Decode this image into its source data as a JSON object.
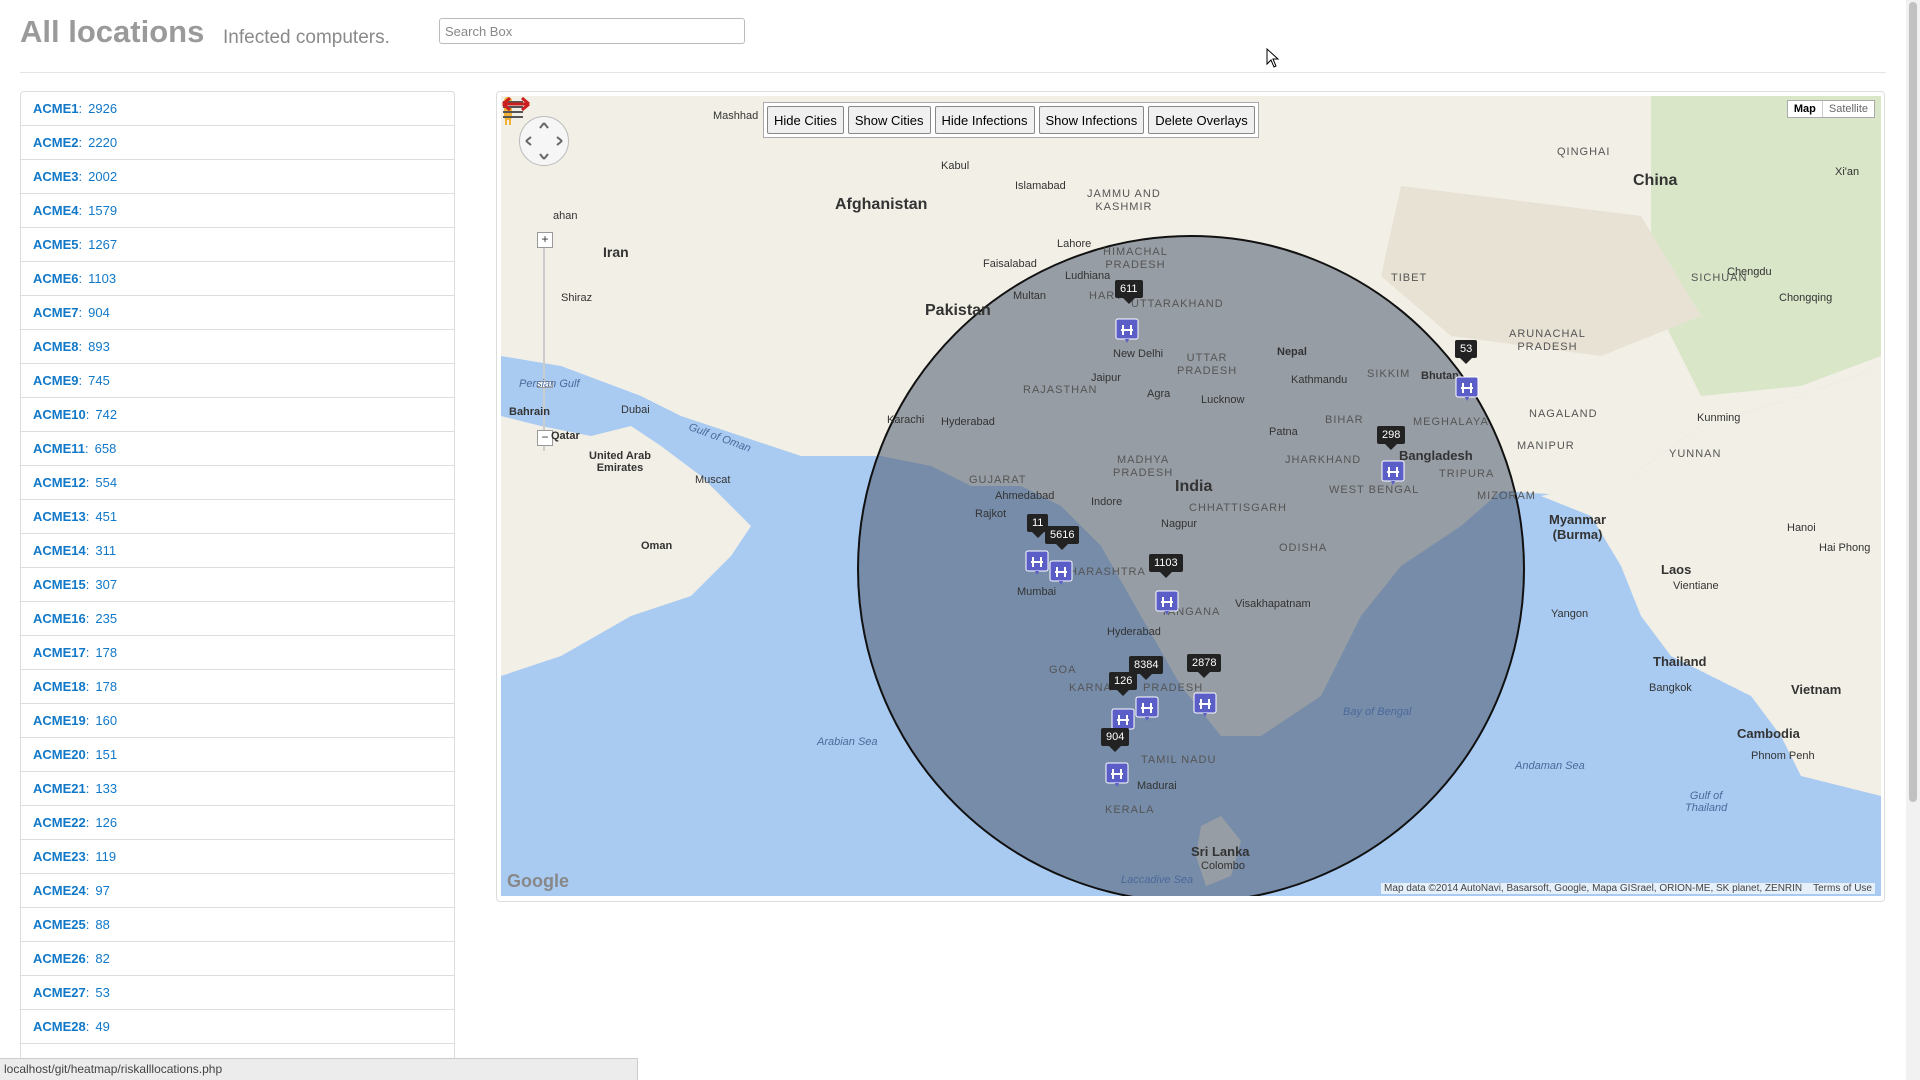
{
  "header": {
    "title": "All locations",
    "subtitle": "Infected computers.",
    "search_placeholder": "Search Box"
  },
  "locations": [
    {
      "name": "ACME1",
      "count": "2926"
    },
    {
      "name": "ACME2",
      "count": "2220"
    },
    {
      "name": "ACME3",
      "count": "2002"
    },
    {
      "name": "ACME4",
      "count": "1579"
    },
    {
      "name": "ACME5",
      "count": "1267"
    },
    {
      "name": "ACME6",
      "count": "1103"
    },
    {
      "name": "ACME7",
      "count": "904"
    },
    {
      "name": "ACME8",
      "count": "893"
    },
    {
      "name": "ACME9",
      "count": "745"
    },
    {
      "name": "ACME10",
      "count": "742"
    },
    {
      "name": "ACME11",
      "count": "658"
    },
    {
      "name": "ACME12",
      "count": "554"
    },
    {
      "name": "ACME13",
      "count": "451"
    },
    {
      "name": "ACME14",
      "count": "311"
    },
    {
      "name": "ACME15",
      "count": "307"
    },
    {
      "name": "ACME16",
      "count": "235"
    },
    {
      "name": "ACME17",
      "count": "178"
    },
    {
      "name": "ACME18",
      "count": "178"
    },
    {
      "name": "ACME19",
      "count": "160"
    },
    {
      "name": "ACME20",
      "count": "151"
    },
    {
      "name": "ACME21",
      "count": "133"
    },
    {
      "name": "ACME22",
      "count": "126"
    },
    {
      "name": "ACME23",
      "count": "119"
    },
    {
      "name": "ACME24",
      "count": "97"
    },
    {
      "name": "ACME25",
      "count": "88"
    },
    {
      "name": "ACME26",
      "count": "82"
    },
    {
      "name": "ACME27",
      "count": "53"
    },
    {
      "name": "ACME28",
      "count": "49"
    }
  ],
  "map": {
    "buttons": {
      "hide_cities": "Hide Cities",
      "show_cities": "Show Cities",
      "hide_infections": "Hide Infections",
      "show_infections": "Show Infections",
      "delete_overlays": "Delete Overlays"
    },
    "map_type": {
      "map": "Map",
      "satellite": "Satellite"
    },
    "logo": "Google",
    "attribution": "Map data ©2014 AutoNavi, Basarsoft, Google, Mapa GISrael, ORION-ME, SK planet, ZENRIN",
    "terms": "Terms of Use",
    "labels": {
      "afghanistan": "Afghanistan",
      "iran": "Iran",
      "pakistan": "Pakistan",
      "india": "India",
      "china": "China",
      "nepal": "Nepal",
      "bhutan": "Bhutan",
      "bangladesh": "Bangladesh",
      "myanmar": "Myanmar\n(Burma)",
      "thailand": "Thailand",
      "laos": "Laos",
      "vietnam": "Vietnam",
      "cambodia": "Cambodia",
      "sri_lanka": "Sri Lanka",
      "oman": "Oman",
      "uae": "United Arab\nEmirates",
      "qatar": "Qatar",
      "bahrain": "Bahrain",
      "jammu_kashmir": "JAMMU AND\nKASHMIR",
      "himachal": "HIMACHAL\nPRADESH",
      "uttarakhand": "UTTARAKHAND",
      "uttar_pradesh": "UTTAR\nPRADESH",
      "rajasthan": "RAJASTHAN",
      "madhya_pradesh": "MADHYA\nPRADESH",
      "gujarat": "GUJARAT",
      "maharashtra": "HARASHTRA",
      "chhattisgarh": "CHHATTISGARH",
      "odisha": "ODISHA",
      "jharkhand": "JHARKHAND",
      "bihar": "BIHAR",
      "west_bengal": "WEST BENGAL",
      "sikkim": "SIKKIM",
      "meghalaya": "MEGHALAYA",
      "tripura": "TRIPURA",
      "mizoram": "MIZORAM",
      "manipur": "MANIPUR",
      "nagaland": "NAGALAND",
      "arunachal": "ARUNACHAL\nPRADESH",
      "telangana": "TANGANA",
      "tamil_nadu": "TAMIL NADU",
      "kerala": "KERALA",
      "karnataka": "KARNA",
      "goa": "GOA",
      "andhra": "PRADESH",
      "tibet": "TIBET",
      "qinghai": "QINGHAI",
      "sichuan": "SICHUAN",
      "yunnan": "YUNNAN",
      "haryana": "HARY",
      "kabul": "Kabul",
      "mashhad": "Mashhad",
      "islamabad": "Islamabad",
      "lahore": "Lahore",
      "faisalabad": "Faisalabad",
      "multan": "Multan",
      "ludhiana": "Ludhiana",
      "new_delhi": "New Delhi",
      "jaipur": "Jaipur",
      "agra": "Agra",
      "lucknow": "Lucknow",
      "kathmandu": "Kathmandu",
      "patna": "Patna",
      "karachi": "Karachi",
      "hyderabad_pk": "Hyderabad",
      "ahmedabad": "Ahmedabad",
      "indore": "Indore",
      "rajkot": "Rajkot",
      "nagpur": "Nagpur",
      "mumbai": "Mumbai",
      "hyderabad": "Hyderabad",
      "visakhapatnam": "Visakhapatnam",
      "madurai": "Madurai",
      "colombo": "Colombo",
      "shiraz": "Shiraz",
      "esfahan": "ahan",
      "dubai": "Dubai",
      "muscat": "Muscat",
      "kunming": "Kunming",
      "chengdu": "Chengdu",
      "chongqing": "Chongqing",
      "xian": "Xi'an",
      "hanoi": "Hanoi",
      "hai_phong": "Hai Phong",
      "vientiane": "Vientiane",
      "yangon": "Yangon",
      "bangkok": "Bangkok",
      "phnom_penh": "Phnom Penh",
      "gulf_of_oman": "Gulf of Oman",
      "persian_gulf": "Persian Gulf",
      "arabian_sea": "Arabian Sea",
      "bay_of_bengal": "Bay of Bengal",
      "andaman_sea": "Andaman Sea",
      "laccadive_sea": "Laccadive Sea",
      "gulf_of_thailand": "Gulf of\nThailand"
    },
    "badges": [
      "611",
      "53",
      "298",
      "11",
      "5616",
      "1103",
      "8384",
      "2878",
      "126",
      "904"
    ]
  },
  "status_bar": "localhost/git/heatmap/riskalllocations.php",
  "colors": {
    "link": "#1178c8",
    "circle_fill": "#4d5a6e",
    "marker": "#5b5ec7",
    "land": "#f2efe6",
    "water": "#a9cbf2"
  }
}
